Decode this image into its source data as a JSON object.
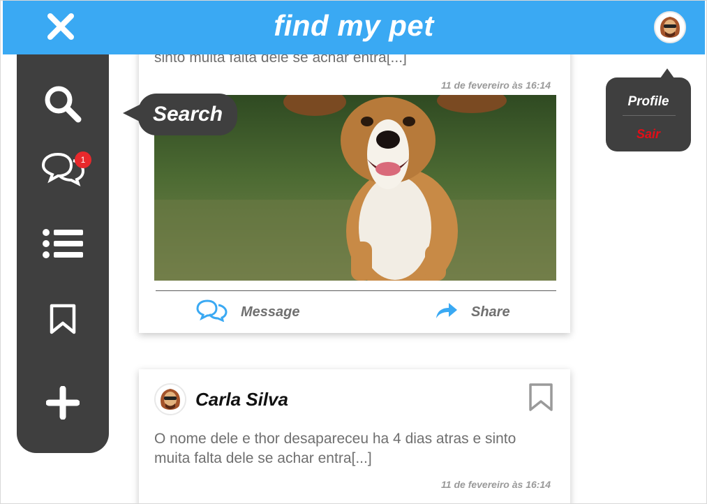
{
  "app": {
    "title": "find my pet"
  },
  "sidebar": {
    "items": [
      {
        "id": "search",
        "icon": "search-icon"
      },
      {
        "id": "messages",
        "icon": "chat-bubbles-icon",
        "badge": "1"
      },
      {
        "id": "list",
        "icon": "list-icon"
      },
      {
        "id": "saved",
        "icon": "bookmark-icon"
      },
      {
        "id": "add",
        "icon": "plus-icon"
      }
    ],
    "tooltip": "Search"
  },
  "profile_menu": {
    "profile_label": "Profile",
    "logout_label": "Sair"
  },
  "posts": [
    {
      "text": "sinto muita falta dele se achar entra[...]",
      "date": "11 de fevereiro às 16:14",
      "photo_icon": "dog-photo",
      "actions": {
        "message": "Message",
        "share": "Share"
      }
    },
    {
      "author": "Carla Silva",
      "text": "O nome dele e thor desapareceu ha 4 dias atras e sinto muita falta dele se achar entra[...]",
      "date": "11 de fevereiro às 16:14"
    }
  ],
  "colors": {
    "brand_blue": "#3aa9f3",
    "sidebar_dark": "#3f3f3f",
    "badge_red": "#e8292c",
    "logout_red": "#e30d17"
  }
}
